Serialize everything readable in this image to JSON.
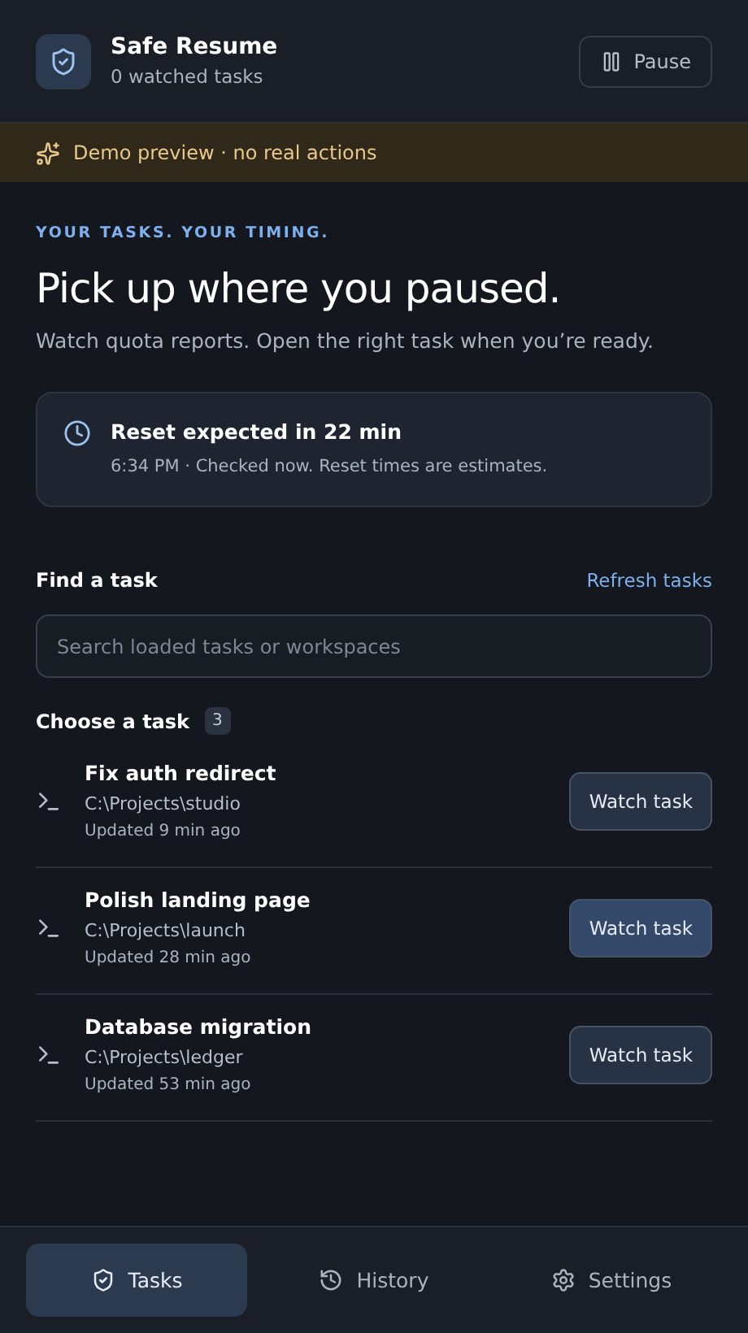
{
  "header": {
    "title": "Safe Resume",
    "subtitle": "0 watched tasks",
    "pause_button": "Pause"
  },
  "banner": {
    "text": "Demo preview · no real actions"
  },
  "hero": {
    "eyebrow": "YOUR TASKS. YOUR TIMING.",
    "title": "Pick up where you paused.",
    "subtitle": "Watch quota reports. Open the right task when you’re ready."
  },
  "reset_card": {
    "title": "Reset expected in 22 min",
    "detail": "6:34 PM · Checked now. Reset times are estimates."
  },
  "search": {
    "label": "Find a task",
    "refresh_link": "Refresh tasks",
    "placeholder": "Search loaded tasks or workspaces"
  },
  "task_list": {
    "label": "Choose a task",
    "count": "3",
    "tasks": [
      {
        "title": "Fix auth redirect",
        "path": "C:\\Projects\\studio",
        "updated": "Updated 9 min ago",
        "button": "Watch task",
        "hovered": false
      },
      {
        "title": "Polish landing page",
        "path": "C:\\Projects\\launch",
        "updated": "Updated 28 min ago",
        "button": "Watch task",
        "hovered": true
      },
      {
        "title": "Database migration",
        "path": "C:\\Projects\\ledger",
        "updated": "Updated 53 min ago",
        "button": "Watch task",
        "hovered": false
      }
    ]
  },
  "nav": [
    {
      "kind": "tasks",
      "label": "Tasks",
      "selected": true
    },
    {
      "kind": "history",
      "label": "History",
      "selected": false
    },
    {
      "kind": "settings",
      "label": "Settings",
      "selected": false
    }
  ]
}
